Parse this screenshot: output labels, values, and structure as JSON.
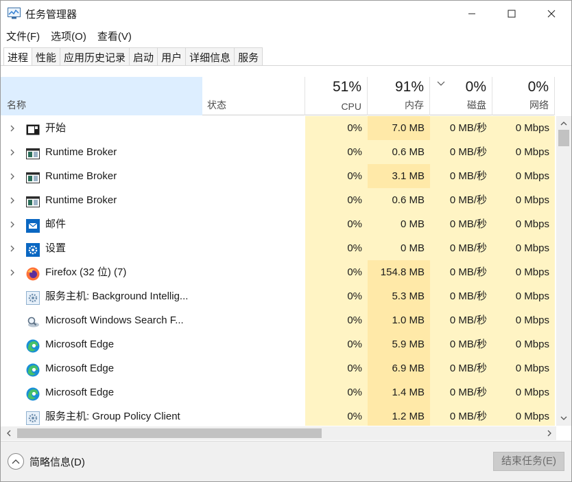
{
  "window": {
    "title": "任务管理器"
  },
  "menu": [
    "文件(F)",
    "选项(O)",
    "查看(V)"
  ],
  "tabs": [
    "进程",
    "性能",
    "应用历史记录",
    "启动",
    "用户",
    "详细信息",
    "服务"
  ],
  "header": {
    "name": "名称",
    "status": "状态",
    "cpu": {
      "pct": "51%",
      "label": "CPU"
    },
    "memory": {
      "pct": "91%",
      "label": "内存"
    },
    "disk": {
      "pct": "0%",
      "label": "磁盘"
    },
    "network": {
      "pct": "0%",
      "label": "网络"
    }
  },
  "processes": [
    {
      "name": "开始",
      "icon": "start-app-icon",
      "expandable": true,
      "cpu": "0%",
      "memory": "7.0 MB",
      "disk": "0 MB/秒",
      "network": "0 Mbps"
    },
    {
      "name": "Runtime Broker",
      "icon": "runtime-broker-icon",
      "expandable": true,
      "cpu": "0%",
      "memory": "0.6 MB",
      "disk": "0 MB/秒",
      "network": "0 Mbps"
    },
    {
      "name": "Runtime Broker",
      "icon": "runtime-broker-icon",
      "expandable": true,
      "cpu": "0%",
      "memory": "3.1 MB",
      "disk": "0 MB/秒",
      "network": "0 Mbps"
    },
    {
      "name": "Runtime Broker",
      "icon": "runtime-broker-icon",
      "expandable": true,
      "cpu": "0%",
      "memory": "0.6 MB",
      "disk": "0 MB/秒",
      "network": "0 Mbps"
    },
    {
      "name": "邮件",
      "icon": "mail-icon",
      "expandable": true,
      "cpu": "0%",
      "memory": "0 MB",
      "disk": "0 MB/秒",
      "network": "0 Mbps"
    },
    {
      "name": "设置",
      "icon": "settings-gear-icon",
      "expandable": true,
      "cpu": "0%",
      "memory": "0 MB",
      "disk": "0 MB/秒",
      "network": "0 Mbps"
    },
    {
      "name": "Firefox (32 位) (7)",
      "icon": "firefox-icon",
      "expandable": true,
      "cpu": "0%",
      "memory": "154.8 MB",
      "disk": "0 MB/秒",
      "network": "0 Mbps"
    },
    {
      "name": "服务主机: Background Intellig...",
      "icon": "service-host-icon",
      "expandable": false,
      "cpu": "0%",
      "memory": "5.3 MB",
      "disk": "0 MB/秒",
      "network": "0 Mbps"
    },
    {
      "name": "Microsoft Windows Search F...",
      "icon": "search-indexer-icon",
      "expandable": false,
      "cpu": "0%",
      "memory": "1.0 MB",
      "disk": "0 MB/秒",
      "network": "0 Mbps"
    },
    {
      "name": "Microsoft Edge",
      "icon": "edge-icon",
      "expandable": false,
      "cpu": "0%",
      "memory": "5.9 MB",
      "disk": "0 MB/秒",
      "network": "0 Mbps"
    },
    {
      "name": "Microsoft Edge",
      "icon": "edge-icon",
      "expandable": false,
      "cpu": "0%",
      "memory": "6.9 MB",
      "disk": "0 MB/秒",
      "network": "0 Mbps"
    },
    {
      "name": "Microsoft Edge",
      "icon": "edge-icon",
      "expandable": false,
      "cpu": "0%",
      "memory": "1.4 MB",
      "disk": "0 MB/秒",
      "network": "0 Mbps"
    },
    {
      "name": "服务主机: Group Policy Client",
      "icon": "service-host-icon",
      "expandable": false,
      "cpu": "0%",
      "memory": "1.2 MB",
      "disk": "0 MB/秒",
      "network": "0 Mbps"
    }
  ],
  "footer": {
    "collapse_label": "简略信息(D)",
    "end_task_label": "结束任务(E)"
  },
  "colors": {
    "heat_light": "#fff4c4",
    "heat_dark": "#ffe9a8",
    "header_selected": "#ddeeff",
    "button_disabled": "#cccccc"
  }
}
